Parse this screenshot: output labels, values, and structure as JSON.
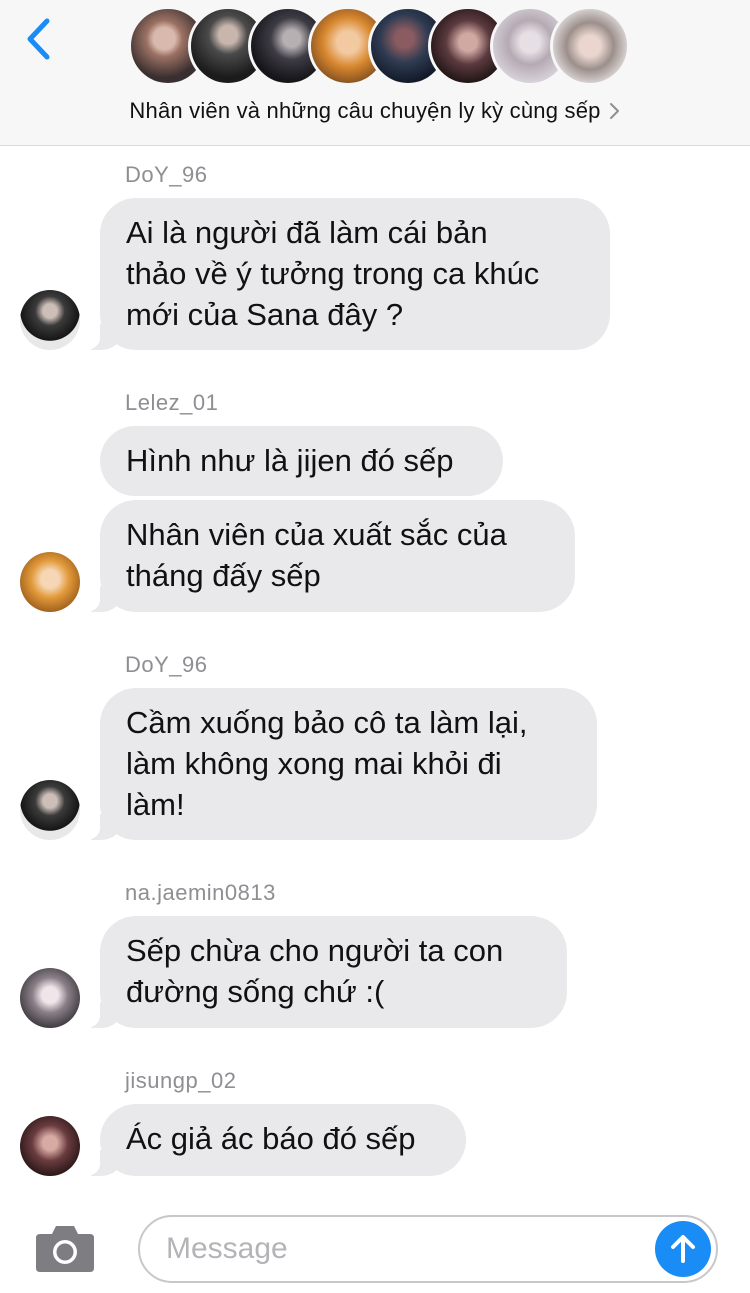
{
  "header": {
    "group_name": "Nhân viên và những câu chuyện ly kỳ cùng sếp",
    "accent_color": "#1a8cf5"
  },
  "messages": [
    {
      "sender": "DoY_96",
      "bubbles": [
        "Ai là người đã làm cái bản\nthảo về ý tưởng trong ca khúc\nmới của Sana đây ?"
      ]
    },
    {
      "sender": "Lelez_01",
      "bubbles": [
        "Hình như là jijen đó sếp",
        "Nhân viên của xuất sắc của\ntháng đấy sếp"
      ]
    },
    {
      "sender": "DoY_96",
      "bubbles": [
        "Cầm xuống bảo cô ta làm lại,\nlàm không xong mai khỏi đi\nlàm!"
      ]
    },
    {
      "sender": "na.jaemin0813",
      "bubbles": [
        "Sếp chừa cho người ta con\nđường sống chứ :("
      ]
    },
    {
      "sender": "jisungp_02",
      "bubbles": [
        "Ác giả ác báo đó sếp"
      ]
    }
  ],
  "composer": {
    "placeholder": "Message",
    "icons": {
      "camera": "camera-icon",
      "send": "arrow-up-icon",
      "back": "chevron-left-icon"
    }
  }
}
